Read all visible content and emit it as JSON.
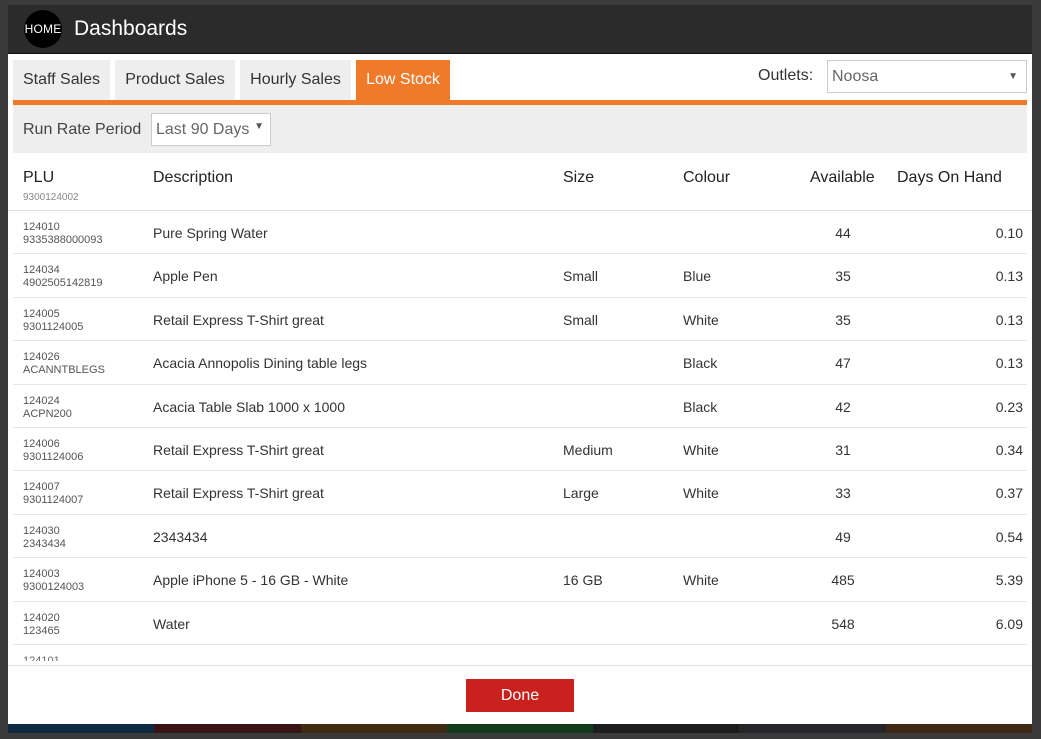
{
  "header": {
    "home_label": "HOME",
    "title": "Dashboards"
  },
  "tabs": [
    {
      "label": "Staff Sales",
      "active": false
    },
    {
      "label": "Product Sales",
      "active": false
    },
    {
      "label": "Hourly Sales",
      "active": false
    },
    {
      "label": "Low Stock",
      "active": true
    }
  ],
  "outlets": {
    "label": "Outlets:",
    "selected": "Noosa"
  },
  "run_rate": {
    "label": "Run Rate Period",
    "selected": "Last 90 Days"
  },
  "table": {
    "columns": {
      "plu": "PLU",
      "description": "Description",
      "size": "Size",
      "colour": "Colour",
      "available": "Available",
      "days_on_hand": "Days On Hand"
    },
    "partial_top_text": "9300124002",
    "rows": [
      {
        "plu": "124010",
        "barcode": "9335388000093",
        "description": "Pure Spring Water",
        "size": "",
        "colour": "",
        "available": "44",
        "days": "0.10"
      },
      {
        "plu": "124034",
        "barcode": "4902505142819",
        "description": "Apple Pen",
        "size": "Small",
        "colour": "Blue",
        "available": "35",
        "days": "0.13"
      },
      {
        "plu": "124005",
        "barcode": "9301124005",
        "description": "Retail Express T-Shirt great",
        "size": "Small",
        "colour": "White",
        "available": "35",
        "days": "0.13"
      },
      {
        "plu": "124026",
        "barcode": "ACANNTBLEGS",
        "description": "Acacia Annopolis Dining table legs",
        "size": "",
        "colour": "Black",
        "available": "47",
        "days": "0.13"
      },
      {
        "plu": "124024",
        "barcode": "ACPN200",
        "description": "Acacia Table Slab 1000 x 1000",
        "size": "",
        "colour": "Black",
        "available": "42",
        "days": "0.23"
      },
      {
        "plu": "124006",
        "barcode": "9301124006",
        "description": "Retail Express T-Shirt great",
        "size": "Medium",
        "colour": "White",
        "available": "31",
        "days": "0.34"
      },
      {
        "plu": "124007",
        "barcode": "9301124007",
        "description": "Retail Express T-Shirt great",
        "size": "Large",
        "colour": "White",
        "available": "33",
        "days": "0.37"
      },
      {
        "plu": "124030",
        "barcode": "2343434",
        "description": "2343434",
        "size": "",
        "colour": "",
        "available": "49",
        "days": "0.54"
      },
      {
        "plu": "124003",
        "barcode": "9300124003",
        "description": "Apple iPhone 5 - 16 GB - White",
        "size": "16 GB",
        "colour": "White",
        "available": "485",
        "days": "5.39"
      },
      {
        "plu": "124020",
        "barcode": "123465",
        "description": "Water",
        "size": "",
        "colour": "",
        "available": "548",
        "days": "6.09"
      }
    ],
    "partial_bottom_text": "124101"
  },
  "footer": {
    "done_label": "Done"
  },
  "colors": {
    "accent": "#ef7a2a",
    "header_bg": "#2b2b2b",
    "done_button": "#c9211e",
    "bottom_strip": [
      "#0e2a3f",
      "#3a1414",
      "#3f2a14",
      "#143a1c",
      "#1c1c1c",
      "#26262a",
      "#3f2814"
    ]
  }
}
